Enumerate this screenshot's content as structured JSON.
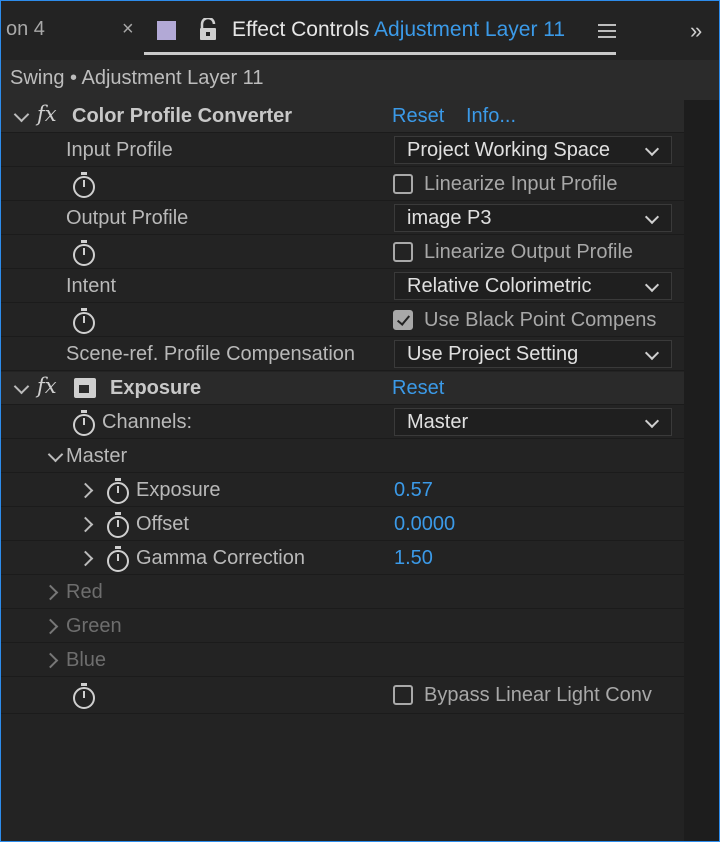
{
  "header": {
    "prev_tab": "on 4",
    "close_glyph": "×",
    "title": "Effect Controls",
    "layer_name": "Adjustment Layer 11",
    "overflow_glyph": "»",
    "icons": [
      "close-icon",
      "label-color-swatch",
      "lock-icon",
      "panel-menu-icon",
      "overflow-icon"
    ],
    "swatch_color": "#b2a9d6",
    "accent_color": "#3b9ae8"
  },
  "subheader": {
    "text": "Swing • Adjustment Layer 11"
  },
  "effects": {
    "cpc": {
      "name": "Color Profile Converter",
      "reset": "Reset",
      "info": "Info...",
      "input_profile_label": "Input Profile",
      "input_profile_value": "Project Working Space",
      "linearize_input_label": "Linearize Input Profile",
      "linearize_input_checked": false,
      "output_profile_label": "Output Profile",
      "output_profile_value": "image P3",
      "linearize_output_label": "Linearize Output Profile",
      "linearize_output_checked": false,
      "intent_label": "Intent",
      "intent_value": "Relative Colorimetric",
      "black_point_label": "Use Black Point Compens",
      "black_point_checked": true,
      "scene_ref_label": "Scene-ref. Profile Compensation",
      "scene_ref_value": "Use Project Setting"
    },
    "exposure": {
      "name": "Exposure",
      "reset": "Reset",
      "channels_label": "Channels:",
      "channels_value": "Master",
      "master_label": "Master",
      "exposure_label": "Exposure",
      "exposure_value": "0.57",
      "offset_label": "Offset",
      "offset_value": "0.0000",
      "gamma_label": "Gamma Correction",
      "gamma_value": "1.50",
      "red_label": "Red",
      "green_label": "Green",
      "blue_label": "Blue",
      "bypass_label": "Bypass Linear Light Conv",
      "bypass_checked": false
    }
  }
}
